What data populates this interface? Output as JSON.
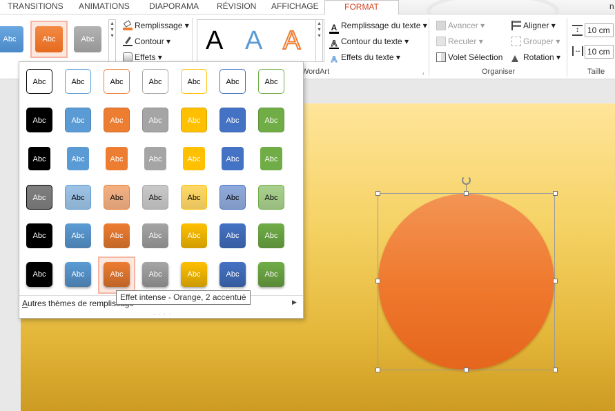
{
  "tabs": [
    "TRANSITIONS",
    "ANIMATIONS",
    "DIAPORAMA",
    "RÉVISION",
    "AFFICHAGE",
    "FORMAT"
  ],
  "tab_corner": "n",
  "shape_styles": {
    "styles": [
      {
        "label": "Abc",
        "color": "#5b9bd5"
      },
      {
        "label": "Abc",
        "color": "#ed7d31"
      },
      {
        "label": "Abc",
        "color": "#a5a5a5"
      }
    ],
    "fill_label": "Remplissage",
    "outline_label": "Contour",
    "effects_label": "Effets"
  },
  "wordart": {
    "group_label": "WordArt",
    "sample": "A",
    "text_fill_label": "Remplissage du texte",
    "text_outline_label": "Contour du texte",
    "text_effects_label": "Effets du texte"
  },
  "arrange": {
    "group_label": "Organiser",
    "bring_forward": "Avancer",
    "send_backward": "Reculer",
    "selection_pane": "Volet Sélection",
    "align": "Aligner",
    "group": "Grouper",
    "rotate": "Rotation"
  },
  "size": {
    "group_label": "Taille",
    "height": "10 cm",
    "width": "10 cm"
  },
  "gallery": {
    "label": "Abc",
    "colors": [
      "#000000",
      "#5b9bd5",
      "#ed7d31",
      "#a5a5a5",
      "#ffc000",
      "#4472c4",
      "#70ad47"
    ],
    "light_colors": [
      "#7f7f7f",
      "#9dc3e6",
      "#f4b183",
      "#c9c9c9",
      "#ffd966",
      "#8faadc",
      "#a9d18e"
    ],
    "more_themes": "Autres thèmes de remplissage",
    "more_themes_underline": "A",
    "more_themes_rest": "utres thèmes de remplissage",
    "tooltip": "Effet intense - Orange, 2 accentué"
  }
}
